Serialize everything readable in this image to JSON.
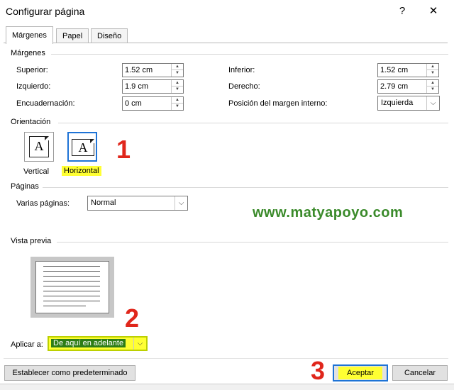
{
  "window": {
    "title": "Configurar página",
    "help": "?",
    "close": "✕"
  },
  "tabs": [
    {
      "label": "Márgenes"
    },
    {
      "label": "Papel"
    },
    {
      "label": "Diseño"
    }
  ],
  "margins": {
    "heading": "Márgenes",
    "top_label": "Superior:",
    "top_value": "1.52 cm",
    "bottom_label": "Inferior:",
    "bottom_value": "1.52 cm",
    "left_label": "Izquierdo:",
    "left_value": "1.9 cm",
    "right_label": "Derecho:",
    "right_value": "2.79 cm",
    "gutter_label": "Encuadernación:",
    "gutter_value": "0 cm",
    "gutter_pos_label": "Posición del margen interno:",
    "gutter_pos_value": "Izquierda"
  },
  "orientation": {
    "heading": "Orientación",
    "portrait_label": "Vertical",
    "landscape_label": "Horizontal",
    "icon_letter": "A",
    "selected": "landscape"
  },
  "pages": {
    "heading": "Páginas",
    "multiple_label": "Varias páginas:",
    "multiple_value": "Normal"
  },
  "preview": {
    "heading": "Vista previa"
  },
  "apply": {
    "label": "Aplicar a:",
    "value": "De aquí en adelante"
  },
  "annotations": {
    "n1": "1",
    "n2": "2",
    "n3": "3",
    "watermark": "www.matyapoyo.com"
  },
  "buttons": {
    "set_default": "Establecer como predeterminado",
    "ok": "Aceptar",
    "cancel": "Cancelar"
  },
  "colors": {
    "accent": "#1e73d6",
    "highlight": "#ffff33",
    "annotation": "#e0261b",
    "watermark": "#3a8a2a"
  }
}
